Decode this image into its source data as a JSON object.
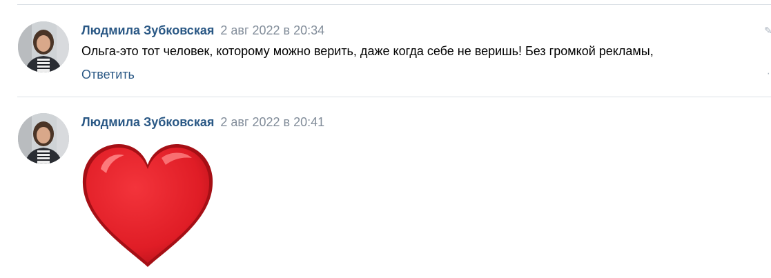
{
  "comments": [
    {
      "author": "Людмила Зубковская",
      "timestamp": "2 авг 2022 в 20:34",
      "text": "Ольга-это тот человек, которому можно верить, даже когда себе не веришь! Без громкой рекламы,",
      "reply_label": "Ответить"
    },
    {
      "author": "Людмила Зубковская",
      "timestamp": "2 авг 2022 в 20:41",
      "sticker": "red-heart-sticker"
    }
  ],
  "colors": {
    "author": "#2a5885",
    "timestamp": "#818c99",
    "divider": "#dce1e6",
    "heart": "#e8202a"
  },
  "icons": {
    "edit": "pencil-icon",
    "more": "more-icon"
  }
}
